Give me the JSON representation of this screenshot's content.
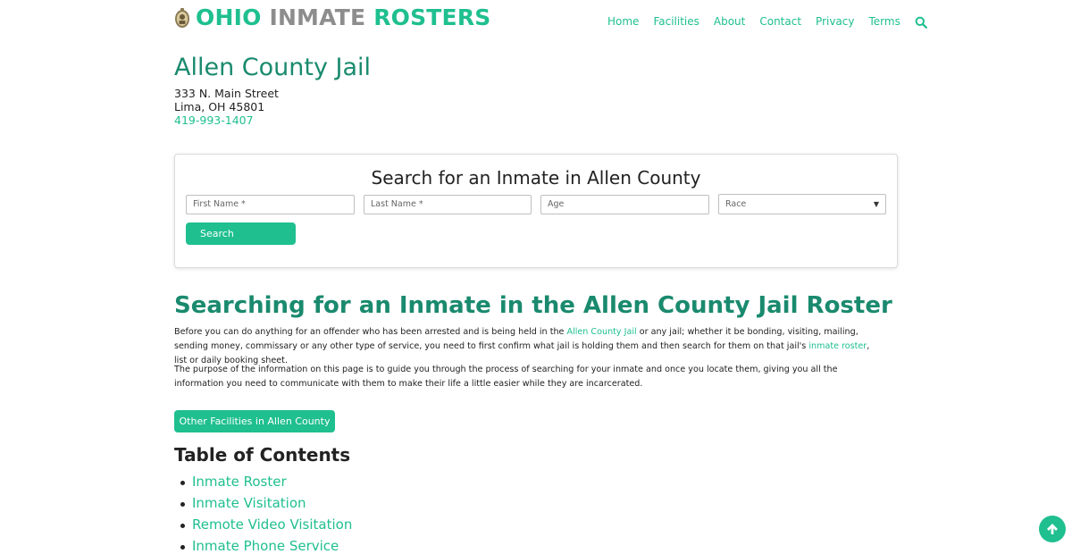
{
  "header": {
    "logo": {
      "word1": "OHIO",
      "word2": "INMATE",
      "word3": "ROSTERS"
    },
    "nav": [
      "Home",
      "Facilities",
      "About",
      "Contact",
      "Privacy",
      "Terms"
    ],
    "search_icon": "search-icon"
  },
  "jail": {
    "title": "Allen County Jail",
    "street": "333 N. Main Street",
    "city": "Lima, OH 45801",
    "phone": "419-993-1407"
  },
  "search": {
    "title": "Search for an Inmate in Allen County",
    "first_name_placeholder": "First Name *",
    "last_name_placeholder": "Last Name *",
    "age_placeholder": "Age",
    "race_selected": "Race",
    "button": "Search"
  },
  "section": {
    "title": "Searching for an Inmate in the Allen County Jail Roster",
    "p1_a": "Before you can do anything for an offender who has been arrested and is being held in the ",
    "p1_link1": "Allen County Jail",
    "p1_b": " or any jail; whether it be bonding, visiting, mailing, sending money, commissary or any other type of service, you need to first confirm what jail is holding them and then search for them on that jail's ",
    "p1_link2": "inmate roster",
    "p1_c": ", list or daily booking sheet.",
    "p2": "The purpose of the information on this page is to guide you through the process of searching for your inmate and once you locate them, giving you all the information you need to communicate with them to make their life a little easier while they are incarcerated.",
    "other_button": "Other Facilities in Allen County"
  },
  "toc": {
    "title": "Table of Contents",
    "items": [
      "Inmate Roster",
      "Inmate Visitation",
      "Remote Video Visitation",
      "Inmate Phone Service"
    ]
  },
  "colors": {
    "accent": "#1fbf8f",
    "heading": "#1a8a6e",
    "logo_gray": "#8d8d8d"
  },
  "back_to_top_icon": "arrow-up-icon"
}
